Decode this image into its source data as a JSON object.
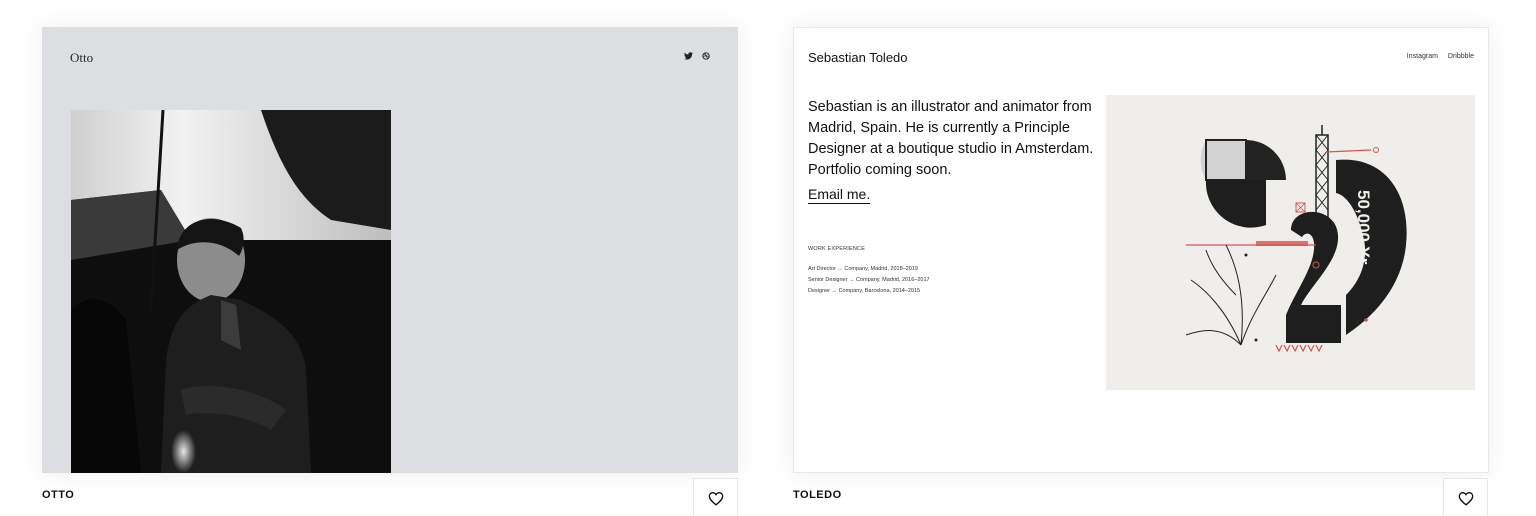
{
  "cards": [
    {
      "caption": "OTTO",
      "preview": {
        "logo": "Otto",
        "social_icons": [
          "twitter-icon",
          "dribbble-icon"
        ],
        "background": "#dcdee1"
      }
    },
    {
      "caption": "TOLEDO",
      "preview": {
        "name": "Sebastian Toledo",
        "nav": [
          "Instagram",
          "Dribbble"
        ],
        "bio": "Sebastian is an illustrator and animator from Madrid, Spain. He is currently a Principle Designer at a boutique studio in Amsterdam. Portfolio coming soon.",
        "email_link": "Email me.",
        "work_title": "WORK EXPERIENCE",
        "work": [
          "Art Director → Company, Madrid, 2018–2019",
          "Senior Designer → Company, Madrid, 2016–2017",
          "Designer → Company, Barcelona, 2014–2015"
        ],
        "art": {
          "number": "2",
          "years_label": "50,000 Yr.",
          "banner": "ADAPTATION",
          "accent": "#d9534f",
          "background": "#efeeea"
        }
      }
    }
  ],
  "favorite_icon": "heart-icon"
}
